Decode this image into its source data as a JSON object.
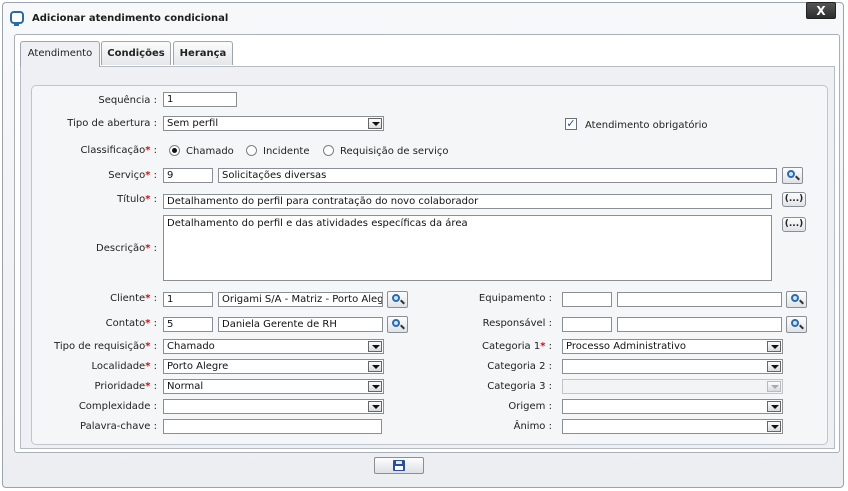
{
  "window": {
    "title": "Adicionar atendimento condicional",
    "close_label": "X"
  },
  "tabs": [
    {
      "label": "Atendimento",
      "active": true
    },
    {
      "label": "Condições",
      "active": false
    },
    {
      "label": "Herança",
      "active": false
    }
  ],
  "form": {
    "sequencia": {
      "label": "Sequência",
      "value": "1"
    },
    "tipo_abertura": {
      "label": "Tipo de abertura",
      "value": "Sem perfil"
    },
    "atendimento_obrigatorio": {
      "label": "Atendimento obrigatório",
      "checked": true
    },
    "classificacao": {
      "label": "Classificação",
      "options": [
        "Chamado",
        "Incidente",
        "Requisição de serviço"
      ],
      "selected": "Chamado"
    },
    "servico": {
      "label": "Serviço",
      "code": "9",
      "name": "Solicitações diversas"
    },
    "titulo": {
      "label": "Título",
      "value": "Detalhamento do perfil para contratação do novo colaborador"
    },
    "descricao": {
      "label": "Descrição",
      "value": "Detalhamento do perfil e das atividades específicas da área"
    },
    "cliente": {
      "label": "Cliente",
      "code": "1",
      "name": "Origami S/A - Matriz - Porto Alegre"
    },
    "contato": {
      "label": "Contato",
      "code": "5",
      "name": "Daniela Gerente de RH"
    },
    "tipo_requisicao": {
      "label": "Tipo de requisição",
      "value": "Chamado"
    },
    "localidade": {
      "label": "Localidade",
      "value": "Porto Alegre"
    },
    "prioridade": {
      "label": "Prioridade",
      "value": "Normal"
    },
    "complexidade": {
      "label": "Complexidade",
      "value": ""
    },
    "palavra_chave": {
      "label": "Palavra-chave",
      "value": ""
    },
    "equipamento": {
      "label": "Equipamento",
      "code": "",
      "name": ""
    },
    "responsavel": {
      "label": "Responsável",
      "code": "",
      "name": ""
    },
    "categoria1": {
      "label": "Categoria 1",
      "value": "Processo Administrativo"
    },
    "categoria2": {
      "label": "Categoria 2",
      "value": ""
    },
    "categoria3": {
      "label": "Categoria 3",
      "value": ""
    },
    "origem": {
      "label": "Origem",
      "value": ""
    },
    "animo": {
      "label": "Ânimo",
      "value": ""
    }
  },
  "buttons": {
    "ellipsis": "(...)"
  }
}
